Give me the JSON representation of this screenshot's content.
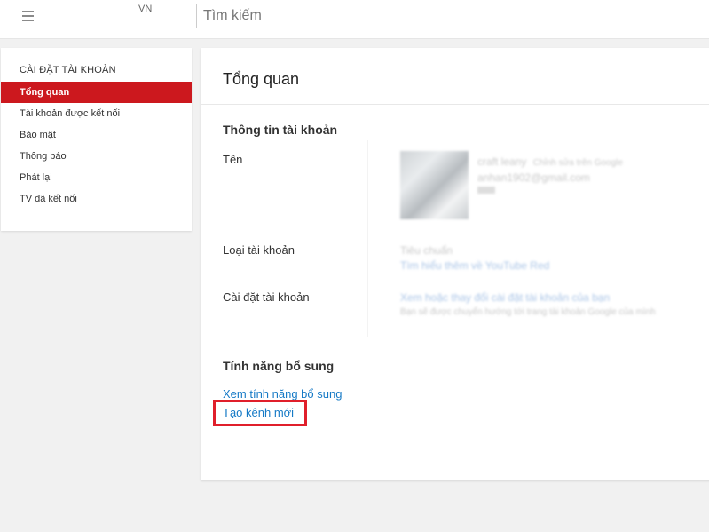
{
  "header": {
    "region": "VN",
    "search_placeholder": "Tìm kiếm"
  },
  "sidebar": {
    "heading": "CÀI ĐẶT TÀI KHOẢN",
    "items": [
      {
        "label": "Tổng quan",
        "active": true
      },
      {
        "label": "Tài khoản được kết nối"
      },
      {
        "label": "Bảo mật"
      },
      {
        "label": "Thông báo"
      },
      {
        "label": "Phát lại"
      },
      {
        "label": "TV đã kết nối"
      }
    ]
  },
  "main": {
    "title": "Tổng quan",
    "account_info": {
      "heading": "Thông tin tài khoản",
      "name_label": "Tên",
      "name_value": "craft leany",
      "name_edit": "Chỉnh sửa trên Google",
      "email_value": "anhan1902@gmail.com",
      "account_type_label": "Loại tài khoản",
      "account_type_value": "Tiêu chuẩn",
      "account_type_link": "Tìm hiểu thêm về YouTube Red",
      "settings_label": "Cài đặt tài khoản",
      "settings_link": "Xem hoặc thay đổi cài đặt tài khoản của bạn",
      "settings_note": "Bạn sẽ được chuyển hướng tới trang tài khoản Google của mình"
    },
    "features": {
      "heading": "Tính năng bổ sung",
      "view_features_link": "Xem tính năng bổ sung",
      "create_channel_link": "Tạo kênh mới"
    }
  }
}
